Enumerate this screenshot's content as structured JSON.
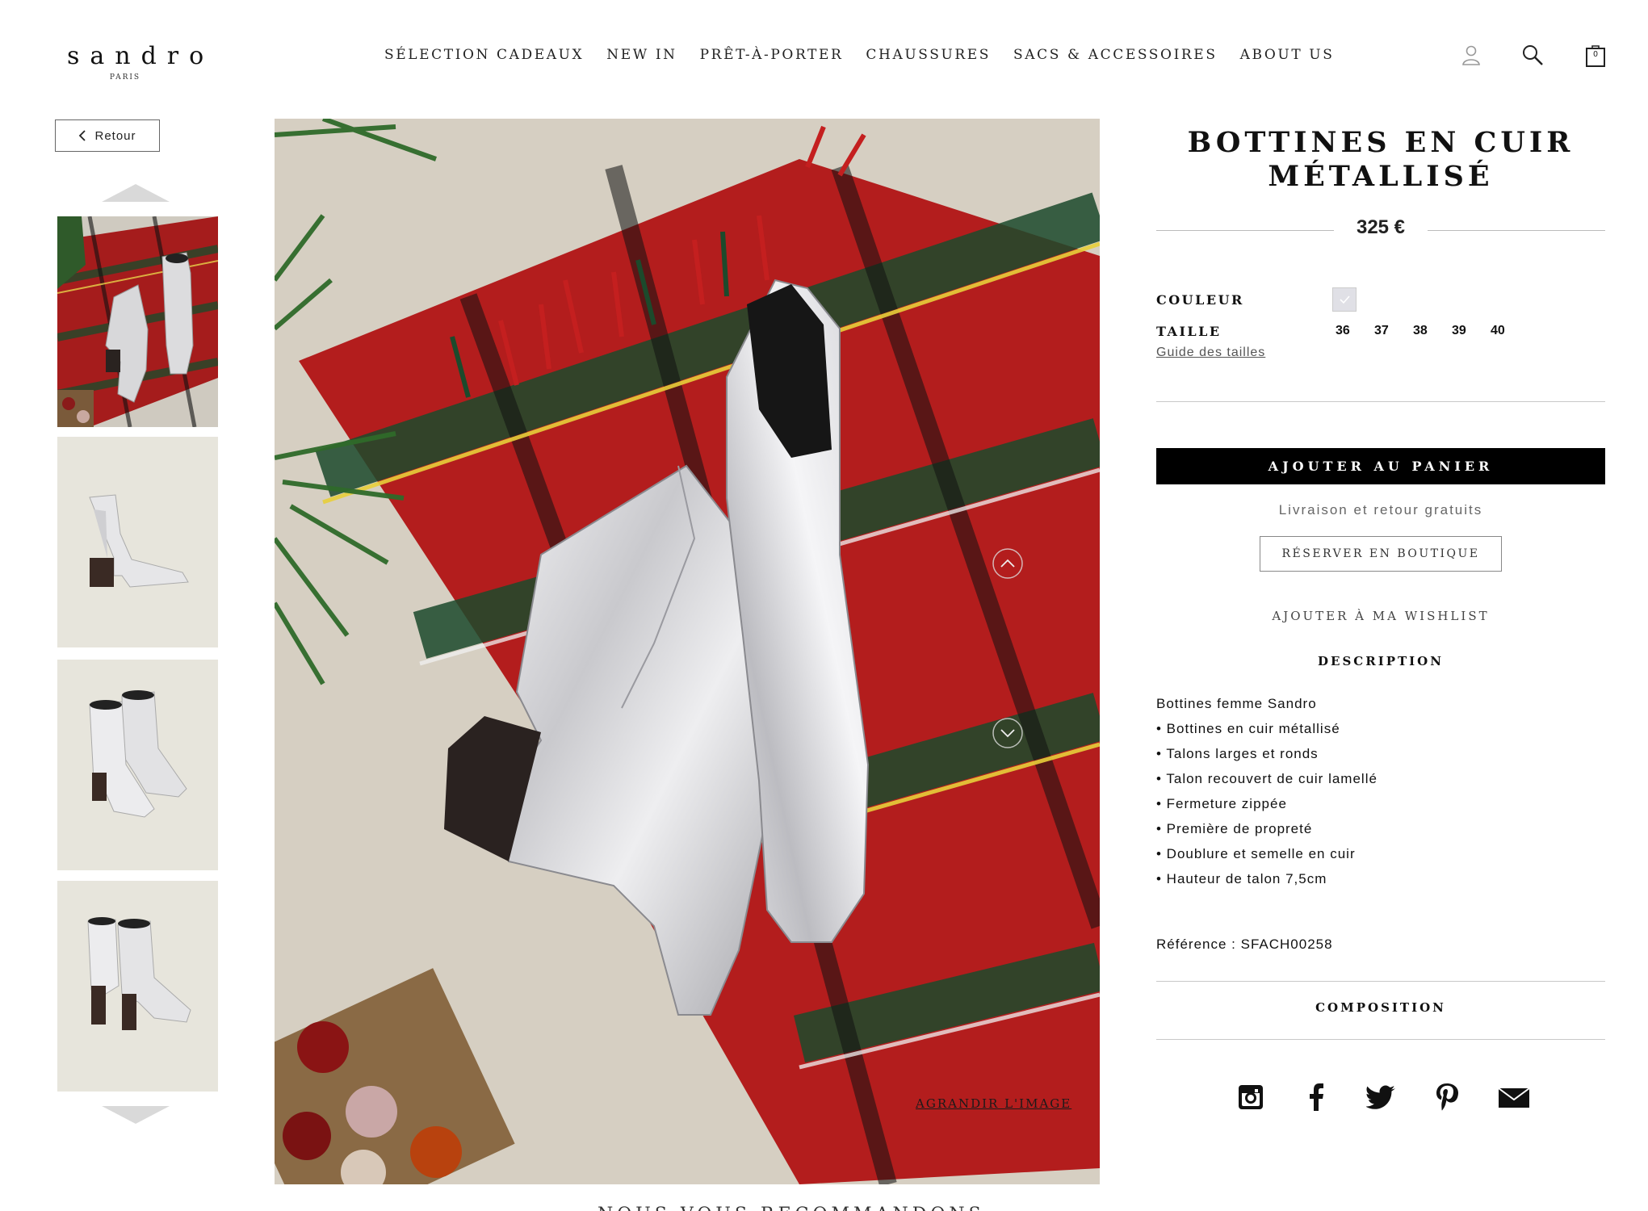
{
  "brand": {
    "name": "sandro",
    "sub": "PARIS"
  },
  "nav": [
    {
      "label": "SÉLECTION CADEAUX"
    },
    {
      "label": "NEW IN"
    },
    {
      "label": "PRÊT-À-PORTER"
    },
    {
      "label": "CHAUSSURES"
    },
    {
      "label": "SACS & ACCESSOIRES"
    },
    {
      "label": "ABOUT US"
    }
  ],
  "header_icons": {
    "account": "user-icon",
    "search": "search-icon",
    "bag": "bag-icon",
    "bag_count": "0"
  },
  "back": {
    "label": "Retour"
  },
  "gallery": {
    "enlarge_label": "AGRANDIR L'IMAGE",
    "thumbnails": [
      "lifestyle-plaid",
      "side-single",
      "pair-front",
      "pair-back"
    ]
  },
  "product": {
    "title": "BOTTINES EN CUIR MÉTALLISÉ",
    "price": "325 €",
    "color_label": "COULEUR",
    "size_label": "TAILLE",
    "sizes": [
      "36",
      "37",
      "38",
      "39",
      "40"
    ],
    "size_guide": "Guide des tailles",
    "add_to_cart": "AJOUTER AU PANIER",
    "shipping": "Livraison et retour gratuits",
    "reserve": "RÉSERVER EN BOUTIQUE",
    "wishlist": "AJOUTER À MA WISHLIST",
    "description_heading": "DESCRIPTION",
    "description": [
      "Bottines femme Sandro",
      "• Bottines en cuir métallisé",
      "• Talons larges et ronds",
      "• Talon recouvert de cuir lamellé",
      "• Fermeture zippée",
      "• Première de propreté",
      "• Doublure et semelle en cuir",
      "• Hauteur de talon 7,5cm"
    ],
    "reference": "Référence : SFACH00258",
    "composition_heading": "COMPOSITION"
  },
  "social": [
    "instagram-icon",
    "facebook-icon",
    "twitter-icon",
    "pinterest-icon",
    "email-icon"
  ],
  "teaser": "NOUS VOUS RECOMMANDONS",
  "colors": {
    "accent": "#000000",
    "swatch": "#e0e0e6",
    "thumb_bg": "#e7e5dc"
  }
}
